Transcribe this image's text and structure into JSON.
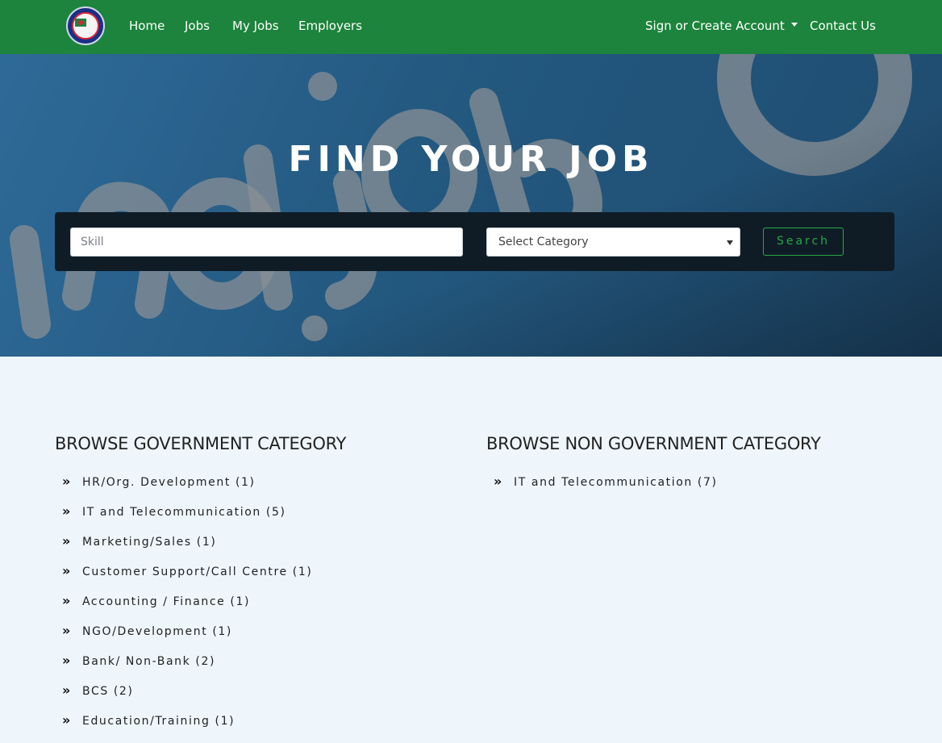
{
  "nav": {
    "logo_name": "bcs-logo",
    "links": [
      {
        "label": "Home"
      },
      {
        "label": "Jobs"
      },
      {
        "label": "My Jobs"
      },
      {
        "label": "Employers"
      }
    ],
    "account_label": "Sign or Create Account",
    "contact_label": "Contact Us"
  },
  "hero": {
    "title": "FIND YOUR JOB",
    "skill_placeholder": "Skill",
    "category_selected": "Select Category",
    "search_label": "Search"
  },
  "government": {
    "heading": "BROWSE GOVERNMENT CATEGORY",
    "items": [
      {
        "label": "HR/Org. Development (1)"
      },
      {
        "label": "IT and Telecommunication (5)"
      },
      {
        "label": "Marketing/Sales (1)"
      },
      {
        "label": "Customer Support/Call Centre (1)"
      },
      {
        "label": "Accounting / Finance (1)"
      },
      {
        "label": "NGO/Development (1)"
      },
      {
        "label": "Bank/ Non-Bank (2)"
      },
      {
        "label": "BCS (2)"
      },
      {
        "label": "Education/Training (1)"
      }
    ]
  },
  "non_government": {
    "heading": "BROWSE NON GOVERNMENT CATEGORY",
    "items": [
      {
        "label": "IT and Telecommunication (7)"
      }
    ]
  },
  "colors": {
    "navbar": "#1c843c",
    "accent_green": "#28a745",
    "hero_blue": "#23587f",
    "page_bg": "#eef6fc"
  },
  "icons": {
    "list_bullet": "double-chevron-right-icon",
    "dropdown": "caret-down-icon"
  }
}
